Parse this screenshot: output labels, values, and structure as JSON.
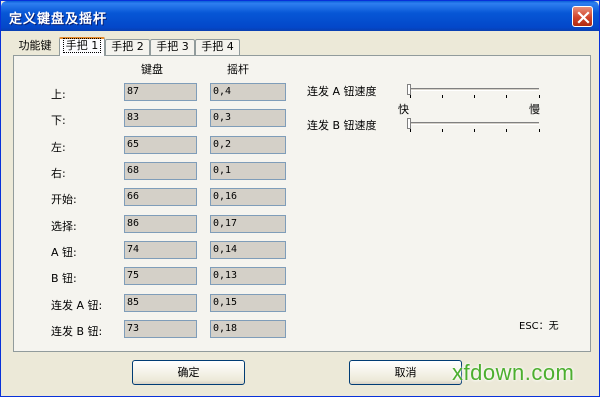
{
  "window": {
    "title": "定义键盘及摇杆",
    "close_icon": "close-icon"
  },
  "tabs": [
    {
      "label": "功能键",
      "active": false
    },
    {
      "label": "手把 1",
      "active": true
    },
    {
      "label": "手把 2",
      "active": false
    },
    {
      "label": "手把 3",
      "active": false
    },
    {
      "label": "手把 4",
      "active": false
    }
  ],
  "columns": {
    "keyboard": "键盘",
    "joystick": "摇杆"
  },
  "mappings": [
    {
      "label": "上:",
      "key": "87",
      "stick": "0,4"
    },
    {
      "label": "下:",
      "key": "83",
      "stick": "0,3"
    },
    {
      "label": "左:",
      "key": "65",
      "stick": "0,2"
    },
    {
      "label": "右:",
      "key": "68",
      "stick": "0,1"
    },
    {
      "label": "开始:",
      "key": "66",
      "stick": "0,16"
    },
    {
      "label": "选择:",
      "key": "86",
      "stick": "0,17"
    },
    {
      "label": "A 钮:",
      "key": "74",
      "stick": "0,14"
    },
    {
      "label": "B 钮:",
      "key": "75",
      "stick": "0,13"
    },
    {
      "label": "连发 A 钮:",
      "key": "85",
      "stick": "0,15"
    },
    {
      "label": "连发 B 钮:",
      "key": "73",
      "stick": "0,18"
    }
  ],
  "turbo": {
    "a_label": "连发 A 钮速度",
    "b_label": "连发 B 钮速度",
    "fast_label": "快",
    "slow_label": "慢",
    "a_value": 0,
    "b_value": 0
  },
  "esc_hint": "ESC：无",
  "buttons": {
    "ok": "确定",
    "cancel": "取消"
  },
  "watermark": "xfdown.com",
  "colors": {
    "titlebar": "#0757d6",
    "active_tab_accent": "#e68b2c",
    "watermark": "#4caf2f"
  }
}
